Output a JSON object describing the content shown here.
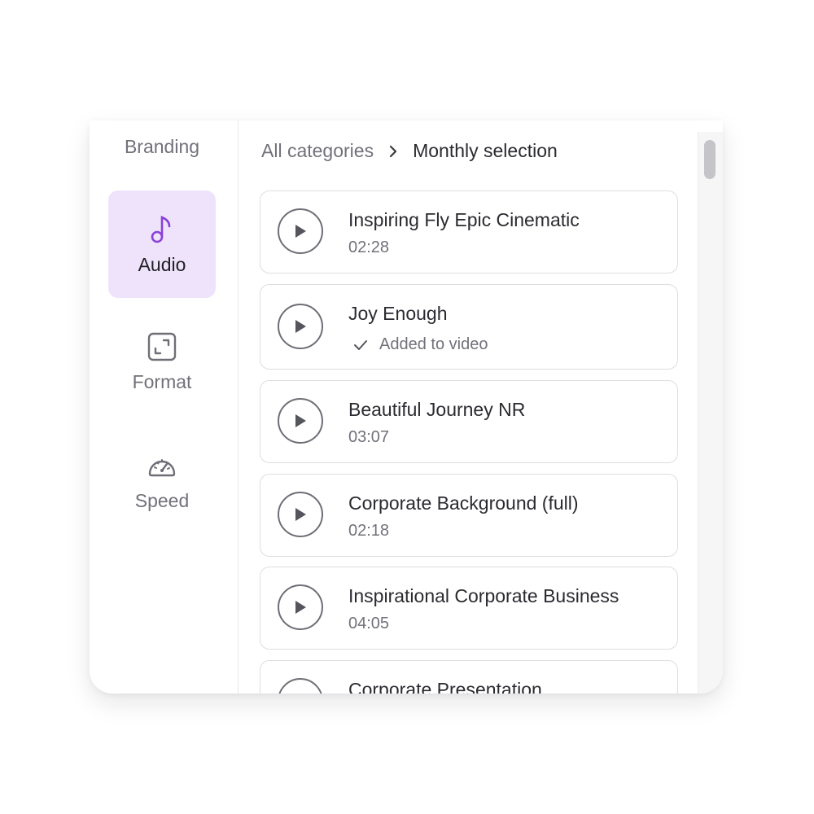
{
  "sidebar": {
    "items": [
      {
        "label": "Branding",
        "icon": "branding-icon"
      },
      {
        "label": "Audio",
        "icon": "music-note-icon",
        "active": true
      },
      {
        "label": "Format",
        "icon": "resize-icon"
      },
      {
        "label": "Speed",
        "icon": "speedometer-icon"
      }
    ],
    "active_color": "#efe3fb",
    "accent_icon_color": "#8b3fd9"
  },
  "breadcrumb": {
    "root": "All categories",
    "separator_icon": "chevron-right-icon",
    "current": "Monthly selection"
  },
  "tracks": [
    {
      "title": "Inspiring Fly Epic Cinematic",
      "duration": "02:28"
    },
    {
      "title": "Joy Enough",
      "status": "Added to video",
      "status_icon": "check-icon"
    },
    {
      "title": "Beautiful Journey NR",
      "duration": "03:07"
    },
    {
      "title": "Corporate Background (full)",
      "duration": "02:18"
    },
    {
      "title": "Inspirational Corporate Business",
      "duration": "04:05"
    },
    {
      "title": "Corporate Presentation"
    }
  ]
}
